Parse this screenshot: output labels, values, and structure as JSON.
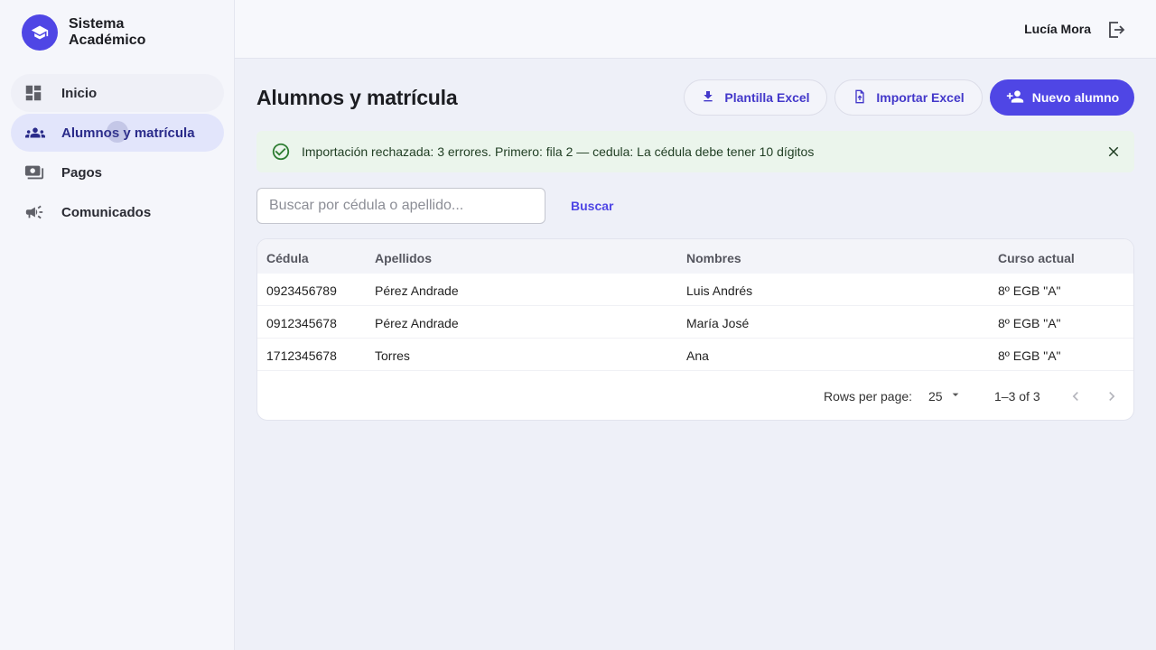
{
  "brand": {
    "name": "Sistema Académico",
    "icon": "graduation-cap-icon",
    "color": "#4f46e5"
  },
  "sidebar": {
    "items": [
      {
        "label": "Inicio",
        "icon": "dashboard-icon"
      },
      {
        "label": "Alumnos y matrícula",
        "icon": "people-icon",
        "active": true
      },
      {
        "label": "Pagos",
        "icon": "payments-icon"
      },
      {
        "label": "Comunicados",
        "icon": "megaphone-icon"
      }
    ]
  },
  "topbar": {
    "user_name": "Lucía Mora",
    "logout_icon": "logout-icon"
  },
  "page": {
    "title": "Alumnos y matrícula"
  },
  "actions": {
    "template_label": "Plantilla Excel",
    "import_label": "Importar Excel",
    "new_label": "Nuevo alumno"
  },
  "alert": {
    "message": "Importación rechazada: 3 errores. Primero: fila 2 — cedula: La cédula debe tener 10 dígitos",
    "color": "#ebf5ec"
  },
  "search": {
    "placeholder": "Buscar por cédula o apellido...",
    "value": "",
    "button_label": "Buscar"
  },
  "table": {
    "headers": [
      "Cédula",
      "Apellidos",
      "Nombres",
      "Curso actual"
    ],
    "rows": [
      [
        "0923456789",
        "Pérez Andrade",
        "Luis Andrés",
        "8º EGB \"A\""
      ],
      [
        "0912345678",
        "Pérez Andrade",
        "María José",
        "8º EGB \"A\""
      ],
      [
        "1712345678",
        "Torres",
        "Ana",
        "8º EGB \"A\""
      ]
    ]
  },
  "pagination": {
    "rows_per_page_label": "Rows per page:",
    "rows_per_page": "25",
    "range": "1–3 of 3"
  }
}
